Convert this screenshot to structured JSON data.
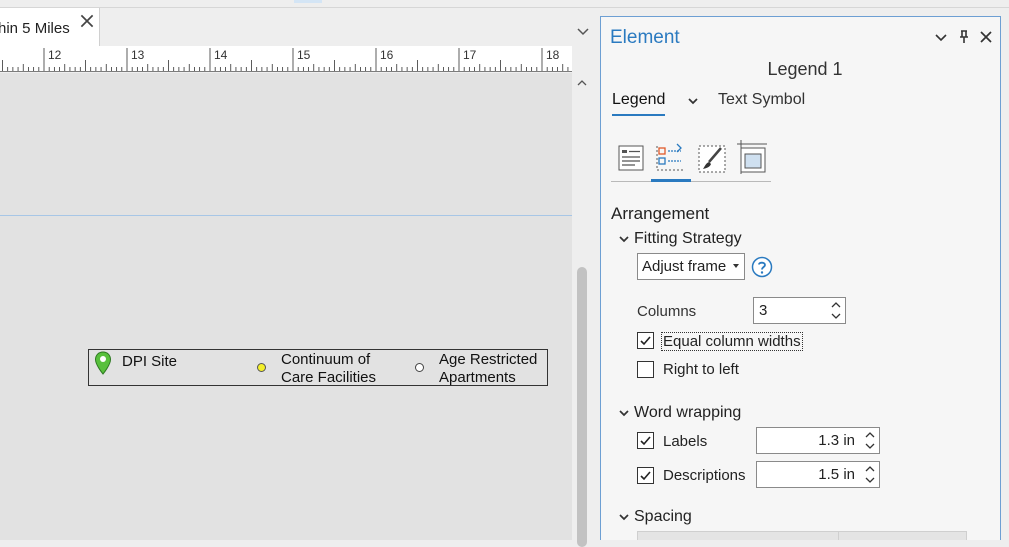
{
  "document_tab": {
    "label": "hin 5 Miles"
  },
  "ruler": {
    "ticks": [
      "12",
      "13",
      "14",
      "15",
      "16",
      "17",
      "18"
    ]
  },
  "legend": {
    "items": [
      {
        "label_lines": [
          "DPI Site"
        ],
        "symbol": "green-pin-icon",
        "color": "#58c03c"
      },
      {
        "label_lines": [
          "Continuum of",
          "Care Facilities"
        ],
        "symbol": "yellow-dot",
        "color": "#f3ef2a"
      },
      {
        "label_lines": [
          "Age Restricted",
          "Apartments"
        ],
        "symbol": "white-dot",
        "color": "#ffffff"
      }
    ]
  },
  "pane": {
    "title": "Element",
    "element_name": "Legend 1",
    "tabs": {
      "legend": "Legend",
      "text_symbol": "Text Symbol"
    },
    "sections": {
      "arrangement": "Arrangement",
      "fitting_strategy": {
        "title": "Fitting Strategy",
        "value": "Adjust frame",
        "columns_label": "Columns",
        "columns_value": "3",
        "equal_widths": {
          "label": "Equal column widths",
          "checked": true
        },
        "right_to_left": {
          "label": "Right to left",
          "checked": false
        }
      },
      "word_wrapping": {
        "title": "Word wrapping",
        "labels": {
          "label": "Labels",
          "checked": true,
          "value": "1.3 in"
        },
        "descriptions": {
          "label": "Descriptions",
          "checked": true,
          "value": "1.5 in"
        }
      },
      "spacing": {
        "title": "Spacing"
      }
    },
    "accent_color": "#2a7ac0"
  }
}
